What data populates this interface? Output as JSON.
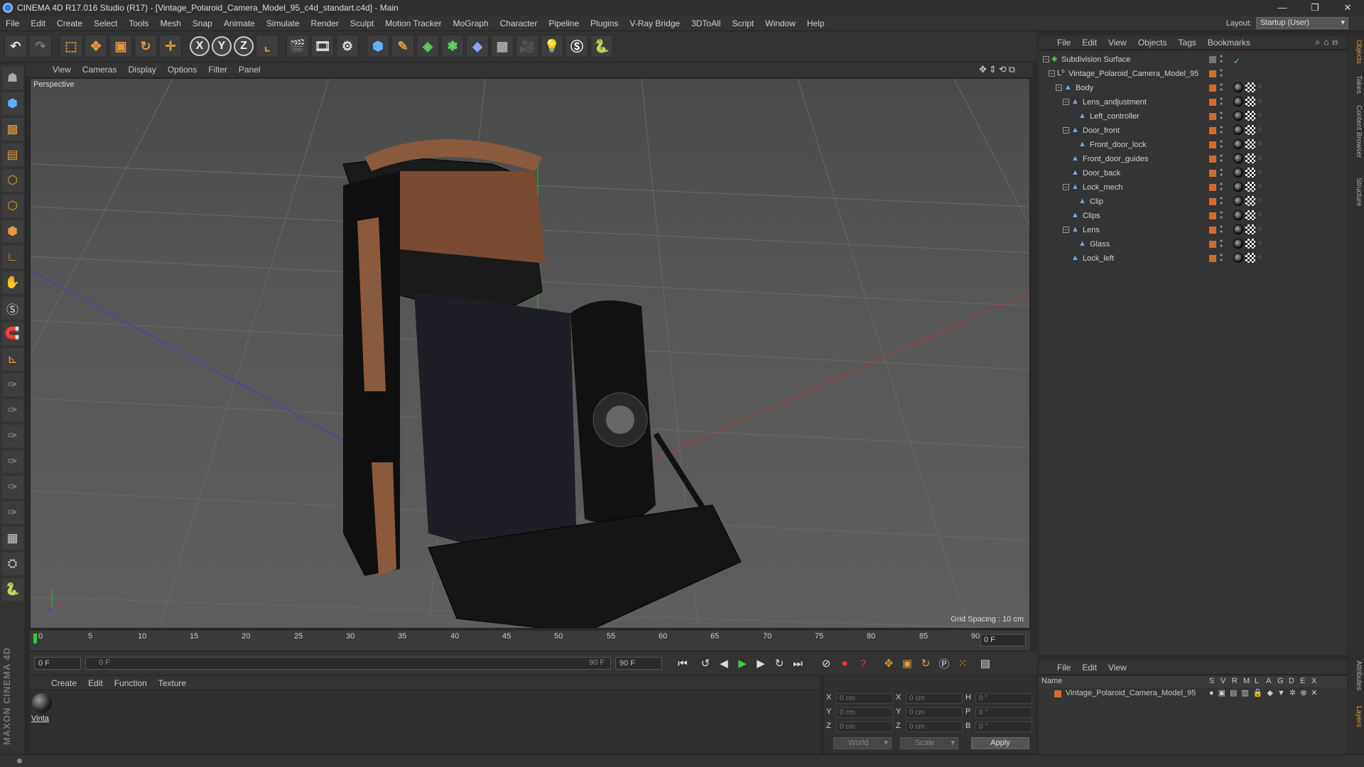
{
  "window": {
    "title": "CINEMA 4D R17.016 Studio (R17) - [Vintage_Polaroid_Camera_Model_95_c4d_standart.c4d] - Main",
    "controls": [
      "—",
      "❐",
      "✕"
    ]
  },
  "menubar": {
    "items": [
      "File",
      "Edit",
      "Create",
      "Select",
      "Tools",
      "Mesh",
      "Snap",
      "Animate",
      "Simulate",
      "Render",
      "Sculpt",
      "Motion Tracker",
      "MoGraph",
      "Character",
      "Pipeline",
      "Plugins",
      "V-Ray Bridge",
      "3DToAll",
      "Script",
      "Window",
      "Help"
    ],
    "layout_label": "Layout:",
    "layout_value": "Startup (User)"
  },
  "toolbar": {
    "axis_x": "X",
    "axis_y": "Y",
    "axis_z": "Z"
  },
  "viewport": {
    "menu": [
      "View",
      "Cameras",
      "Display",
      "Options",
      "Filter",
      "Panel"
    ],
    "label": "Perspective",
    "grid_spacing": "Grid Spacing : 10 cm"
  },
  "timeline": {
    "ticks": [
      "0",
      "5",
      "10",
      "15",
      "20",
      "25",
      "30",
      "35",
      "40",
      "45",
      "50",
      "55",
      "60",
      "65",
      "70",
      "75",
      "80",
      "85",
      "90"
    ],
    "current_frame": "0 F",
    "start_field": "0 F",
    "range_start": "0 F",
    "range_end": "90 F",
    "end_field": "90 F"
  },
  "material_manager": {
    "menu": [
      "Create",
      "Edit",
      "Function",
      "Texture"
    ],
    "material_name": "Vinta"
  },
  "coordinates": {
    "rows": [
      {
        "a": "X",
        "av": "0 cm",
        "b": "X",
        "bv": "0 cm",
        "c": "H",
        "cv": "0 °"
      },
      {
        "a": "Y",
        "av": "0 cm",
        "b": "Y",
        "bv": "0 cm",
        "c": "P",
        "cv": "0 °"
      },
      {
        "a": "Z",
        "av": "0 cm",
        "b": "Z",
        "bv": "0 cm",
        "c": "B",
        "cv": "0 °"
      }
    ],
    "mode_world": "World",
    "mode_scale": "Scale",
    "apply": "Apply"
  },
  "object_manager": {
    "menu": [
      "File",
      "Edit",
      "View",
      "Objects",
      "Tags",
      "Bookmarks"
    ],
    "objects": [
      {
        "name": "Subdivision Surface",
        "depth": 0,
        "icon": "subdivision-icon"
      },
      {
        "name": "Vintage_Polaroid_Camera_Model_95",
        "depth": 1,
        "icon": "null-icon"
      },
      {
        "name": "Body",
        "depth": 2,
        "icon": "polygon-icon"
      },
      {
        "name": "Lens_andjustment",
        "depth": 3,
        "icon": "polygon-icon"
      },
      {
        "name": "Left_controller",
        "depth": 4,
        "icon": "polygon-icon"
      },
      {
        "name": "Door_front",
        "depth": 3,
        "icon": "polygon-icon"
      },
      {
        "name": "Front_door_lock",
        "depth": 4,
        "icon": "polygon-icon"
      },
      {
        "name": "Front_door_guides",
        "depth": 3,
        "icon": "polygon-icon"
      },
      {
        "name": "Door_back",
        "depth": 3,
        "icon": "polygon-icon"
      },
      {
        "name": "Lock_mech",
        "depth": 3,
        "icon": "polygon-icon"
      },
      {
        "name": "Clip",
        "depth": 4,
        "icon": "polygon-icon"
      },
      {
        "name": "Clips",
        "depth": 3,
        "icon": "polygon-icon"
      },
      {
        "name": "Lens",
        "depth": 3,
        "icon": "polygon-icon"
      },
      {
        "name": "Glass",
        "depth": 4,
        "icon": "polygon-icon"
      },
      {
        "name": "Lock_left",
        "depth": 3,
        "icon": "polygon-icon"
      }
    ],
    "layer_color": "#d46a28"
  },
  "layer_manager": {
    "menu": [
      "File",
      "Edit",
      "View"
    ],
    "headers": [
      "Name",
      "S",
      "V",
      "R",
      "M",
      "L",
      "A",
      "G",
      "D",
      "E",
      "X"
    ],
    "layer_name": "Vintage_Polaroid_Camera_Model_95"
  },
  "side_tabs": [
    "Objects",
    "Takes",
    "Content Browser",
    "Structure",
    "Attributes",
    "Layers"
  ]
}
